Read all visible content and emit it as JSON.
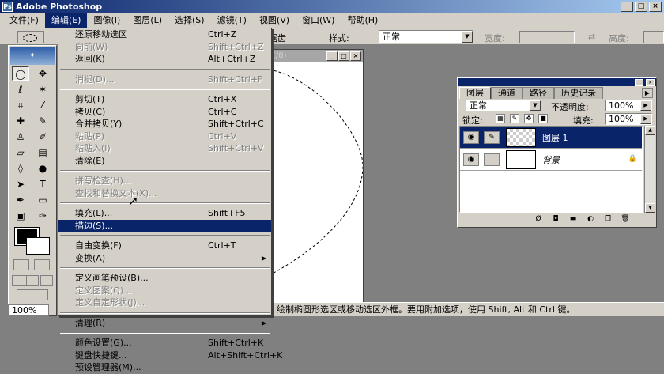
{
  "window": {
    "title": "Adobe Photoshop",
    "min": "_",
    "max": "□",
    "close": "×"
  },
  "menubar": [
    {
      "label": "文件(F)"
    },
    {
      "label": "编辑(E)"
    },
    {
      "label": "图像(I)"
    },
    {
      "label": "图层(L)"
    },
    {
      "label": "选择(S)"
    },
    {
      "label": "滤镜(T)"
    },
    {
      "label": "视图(V)"
    },
    {
      "label": "窗口(W)"
    },
    {
      "label": "帮助(H)"
    }
  ],
  "options": {
    "antialias": "锯齿",
    "style_label": "样式:",
    "style_value": "正常",
    "width_label": "宽度:",
    "height_label": "高度:",
    "swap_icon": "⇄"
  },
  "edit_menu": {
    "items": [
      {
        "label": "还原移动选区",
        "shortcut": "Ctrl+Z",
        "enabled": true
      },
      {
        "label": "向前(W)",
        "shortcut": "Shift+Ctrl+Z",
        "enabled": false
      },
      {
        "label": "返回(K)",
        "shortcut": "Alt+Ctrl+Z",
        "enabled": true
      },
      {
        "label": "消褪(D)...",
        "shortcut": "Shift+Ctrl+F",
        "enabled": false
      },
      {
        "label": "剪切(T)",
        "shortcut": "Ctrl+X",
        "enabled": true
      },
      {
        "label": "拷贝(C)",
        "shortcut": "Ctrl+C",
        "enabled": true
      },
      {
        "label": "合并拷贝(Y)",
        "shortcut": "Shift+Ctrl+C",
        "enabled": true
      },
      {
        "label": "粘贴(P)",
        "shortcut": "Ctrl+V",
        "enabled": false
      },
      {
        "label": "粘贴入(I)",
        "shortcut": "Shift+Ctrl+V",
        "enabled": false
      },
      {
        "label": "清除(E)",
        "shortcut": "",
        "enabled": true
      },
      {
        "label": "拼写检查(H)...",
        "shortcut": "",
        "enabled": false
      },
      {
        "label": "查找和替换文本(X)...",
        "shortcut": "",
        "enabled": false
      },
      {
        "label": "填充(L)...",
        "shortcut": "Shift+F5",
        "enabled": true
      },
      {
        "label": "描边(S)...",
        "shortcut": "",
        "enabled": true,
        "highlighted": true
      },
      {
        "label": "自由变换(F)",
        "shortcut": "Ctrl+T",
        "enabled": true
      },
      {
        "label": "变换(A)",
        "shortcut": "",
        "enabled": true,
        "submenu": true
      },
      {
        "label": "定义画笔预设(B)...",
        "shortcut": "",
        "enabled": true
      },
      {
        "label": "定义图案(Q)...",
        "shortcut": "",
        "enabled": false
      },
      {
        "label": "定义自定形状(J)...",
        "shortcut": "",
        "enabled": false
      },
      {
        "label": "清理(R)",
        "shortcut": "",
        "enabled": true,
        "submenu": true
      },
      {
        "label": "颜色设置(G)...",
        "shortcut": "Shift+Ctrl+K",
        "enabled": true
      },
      {
        "label": "键盘快捷键...",
        "shortcut": "Alt+Shift+Ctrl+K",
        "enabled": true
      },
      {
        "label": "预设管理器(M)...",
        "shortcut": "",
        "enabled": true
      }
    ]
  },
  "toolbox": {
    "zoom": "100%",
    "tools": [
      "marquee-tool",
      "move-tool",
      "lasso-tool",
      "magic-wand-tool",
      "crop-tool",
      "slice-tool",
      "healing-brush-tool",
      "brush-tool",
      "clone-stamp-tool",
      "history-brush-tool",
      "eraser-tool",
      "gradient-tool",
      "blur-tool",
      "dodge-tool",
      "path-selection-tool",
      "type-tool",
      "pen-tool",
      "shape-tool",
      "notes-tool",
      "eyedropper-tool",
      "hand-tool",
      "zoom-tool"
    ]
  },
  "document": {
    "title": "(/8)"
  },
  "statusbar": {
    "text": "绘制椭圆形选区或移动选区外框。要用附加选项，使用 Shift, Alt 和 Ctrl 键。"
  },
  "layers_panel": {
    "tabs": [
      "图层",
      "通道",
      "路径",
      "历史记录"
    ],
    "blend_mode": "正常",
    "opacity_label": "不透明度:",
    "opacity": "100%",
    "lock_label": "锁定:",
    "fill_label": "填充:",
    "fill": "100%",
    "layers": [
      {
        "name": "图层 1",
        "selected": true
      },
      {
        "name": "背景",
        "selected": false,
        "locked": true
      }
    ]
  },
  "colors": {
    "menu_highlight": "#0a246a",
    "chrome": "#d4d0c8",
    "workspace": "#808080"
  }
}
